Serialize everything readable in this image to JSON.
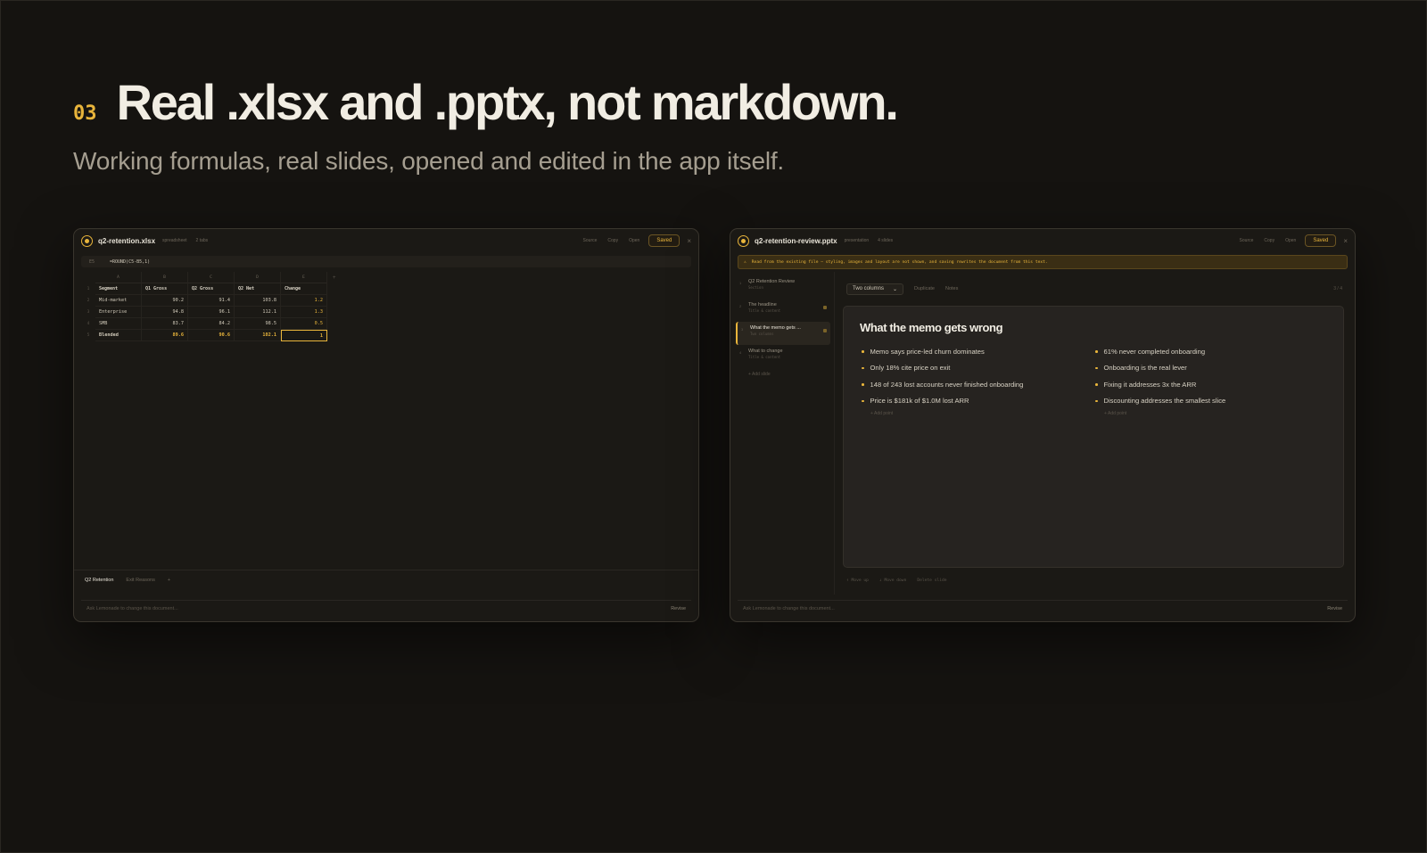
{
  "hero": {
    "number": "03",
    "title": "Real .xlsx and .pptx, not markdown.",
    "subtitle": "Working formulas, real slides, opened and edited in the app itself."
  },
  "spreadsheet": {
    "filename": "q2-retention.xlsx",
    "filetype": "spreadsheet",
    "meta": "2 tabs",
    "toolbar": {
      "source": "Source",
      "copy": "Copy",
      "open": "Open",
      "saved": "Saved",
      "close": "×"
    },
    "cell_ref": "E5",
    "formula": "=ROUND(C5-B5,1)",
    "column_letters": [
      "A",
      "B",
      "C",
      "D",
      "E"
    ],
    "add_column": "+",
    "row_numbers": [
      "1",
      "2",
      "3",
      "4",
      "5"
    ],
    "headers": [
      "Segment",
      "Q1 Gross",
      "Q2 Gross",
      "Q2 Net",
      "Change"
    ],
    "rows": [
      [
        "Mid-market",
        "90.2",
        "91.4",
        "103.8",
        "1.2"
      ],
      [
        "Enterprise",
        "94.8",
        "96.1",
        "112.1",
        "1.3"
      ],
      [
        "SMB",
        "83.7",
        "84.2",
        "98.5",
        "0.5"
      ],
      [
        "Blended",
        "89.6",
        "90.6",
        "102.1",
        "1"
      ]
    ],
    "sheet_tabs": [
      "Q2 Retention",
      "Exit Reasons"
    ],
    "add_tab": "+",
    "ask_placeholder": "Ask Lemonade to change this document...",
    "revise_label": "Revise"
  },
  "presentation": {
    "filename": "q2-retention-review.pptx",
    "filetype": "presentation",
    "meta": "4 slides",
    "toolbar": {
      "source": "Source",
      "copy": "Copy",
      "open": "Open",
      "saved": "Saved",
      "close": "×"
    },
    "warning": "Read from the existing file — styling, images and layout are not shown, and saving rewrites the document from this text.",
    "slides": [
      {
        "num": "1",
        "title": "Q2 Retention Review",
        "sub": "Section"
      },
      {
        "num": "2",
        "title": "The headline",
        "sub": "Title & content"
      },
      {
        "num": "3",
        "title": "What the memo gets ...",
        "sub": "Two columns"
      },
      {
        "num": "4",
        "title": "What to change",
        "sub": "Title & content"
      }
    ],
    "add_slide": "+ Add slide",
    "layout_select": "Two columns",
    "duplicate": "Duplicate",
    "notes": "Notes",
    "page": "3 / 4",
    "slide_title": "What the memo gets wrong",
    "left_bullets": [
      "Memo says price-led churn dominates",
      "Only 18% cite price on exit",
      "148 of 243 lost accounts never finished onboarding",
      "Price is $181k of $1.0M lost ARR"
    ],
    "right_bullets": [
      "61% never completed onboarding",
      "Onboarding is the real lever",
      "Fixing it addresses 3x the ARR",
      "Discounting addresses the smallest slice"
    ],
    "add_point": "+ Add point",
    "actions": [
      "↑ Move up",
      "↓ Move down",
      "Delete slide"
    ],
    "ask_placeholder": "Ask Lemonade to change this document...",
    "revise_label": "Revise"
  },
  "colors": {
    "accent": "#e9b53b",
    "background": "#151310",
    "panel": "#1b1915"
  }
}
